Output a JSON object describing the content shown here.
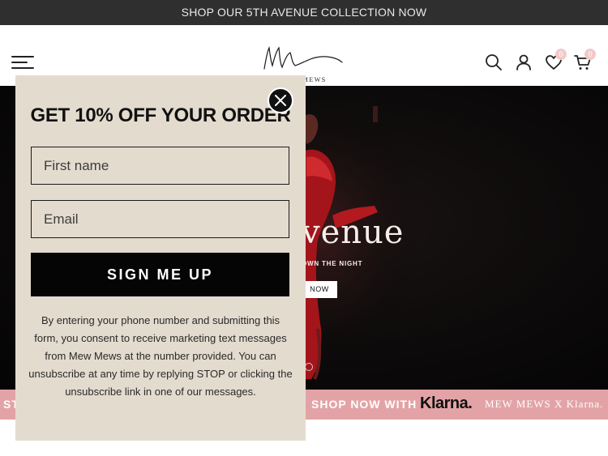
{
  "announcement": {
    "text": "SHOP OUR 5TH AVENUE COLLECTION NOW"
  },
  "header": {
    "logo_text": "MEW MEWS",
    "wishlist_count": "0",
    "cart_count": "0"
  },
  "hero": {
    "title": "venue",
    "subtitle": "OWN THE NIGHT",
    "button_label": "NOW"
  },
  "strip": {
    "left_text": "ST",
    "shop_text": "SHOP NOW WITH",
    "klarna_text": "Klarna.",
    "right_text": "MEW MEWS X Klarna."
  },
  "popup": {
    "title": "GET 10% OFF YOUR ORDER",
    "first_name_placeholder": "First name",
    "email_placeholder": "Email",
    "signup_label": "SIGN ME UP",
    "disclaimer": "By entering your phone number and submitting this form, you consent to receive marketing text messages from Mew Mews at the number provided. You can unsubscribe at any time by replying STOP or clicking the unsubscribe link in one of our messages."
  },
  "colors": {
    "announce_bg": "#2f2f2f",
    "strip_bg": "#e3a3a6",
    "popup_bg": "#e4dbcf",
    "button_bg": "#050505",
    "badge": "#f2c9c9"
  },
  "icons": [
    "menu-icon",
    "search-icon",
    "account-icon",
    "heart-icon",
    "cart-icon",
    "close-icon"
  ]
}
